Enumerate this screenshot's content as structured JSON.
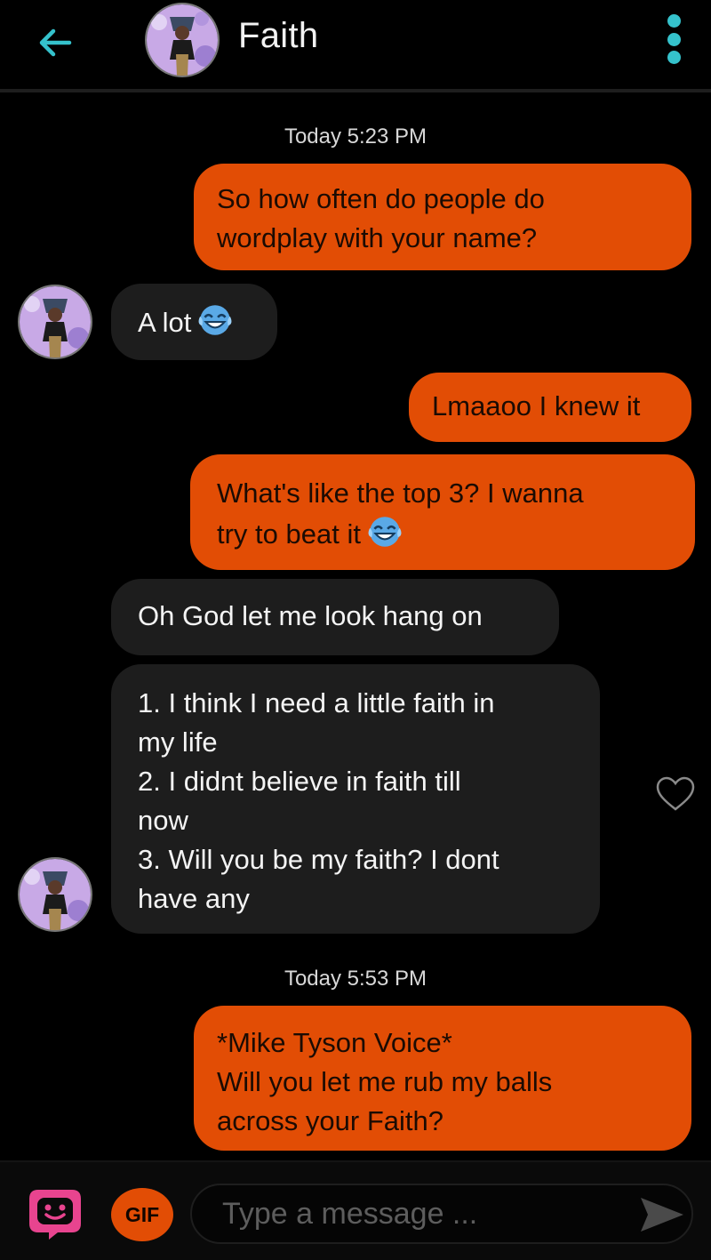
{
  "header": {
    "contact_name": "Faith",
    "back_icon": "arrow-left-icon",
    "menu_icon": "vertical-dots-icon",
    "accent_color": "#35c2cc"
  },
  "conversation": {
    "timestamps": [
      "Today 5:23 PM",
      "Today 5:53 PM"
    ],
    "messages": [
      {
        "sender": "me",
        "lines": [
          "So how often do people do",
          "wordplay with your name?"
        ]
      },
      {
        "sender": "Faith",
        "lines": [
          "A lot"
        ],
        "emoji": "laughing-crying-emoji"
      },
      {
        "sender": "me",
        "lines": [
          "Lmaaoo I knew it"
        ]
      },
      {
        "sender": "me",
        "lines": [
          "What's like the top 3? I wanna",
          "try to beat it"
        ],
        "emoji": "laughing-crying-emoji"
      },
      {
        "sender": "Faith",
        "lines": [
          "Oh God let me look hang on"
        ]
      },
      {
        "sender": "Faith",
        "lines": [
          "1. I think I need a little faith in",
          "my life",
          "2. I didnt believe in faith till",
          "now",
          "3. Will you be my faith? I dont",
          "have any"
        ]
      },
      {
        "sender": "me",
        "lines": [
          "*Mike Tyson Voice*",
          "Will you let me rub my balls",
          "across your Faith?"
        ]
      }
    ],
    "outgoing_color": "#e24d05",
    "incoming_color": "#1d1d1d"
  },
  "composer": {
    "placeholder": "Type a message ...",
    "gif_label": "GIF",
    "sticker_icon": "sticker-face-icon",
    "send_icon": "send-arrow-icon"
  }
}
